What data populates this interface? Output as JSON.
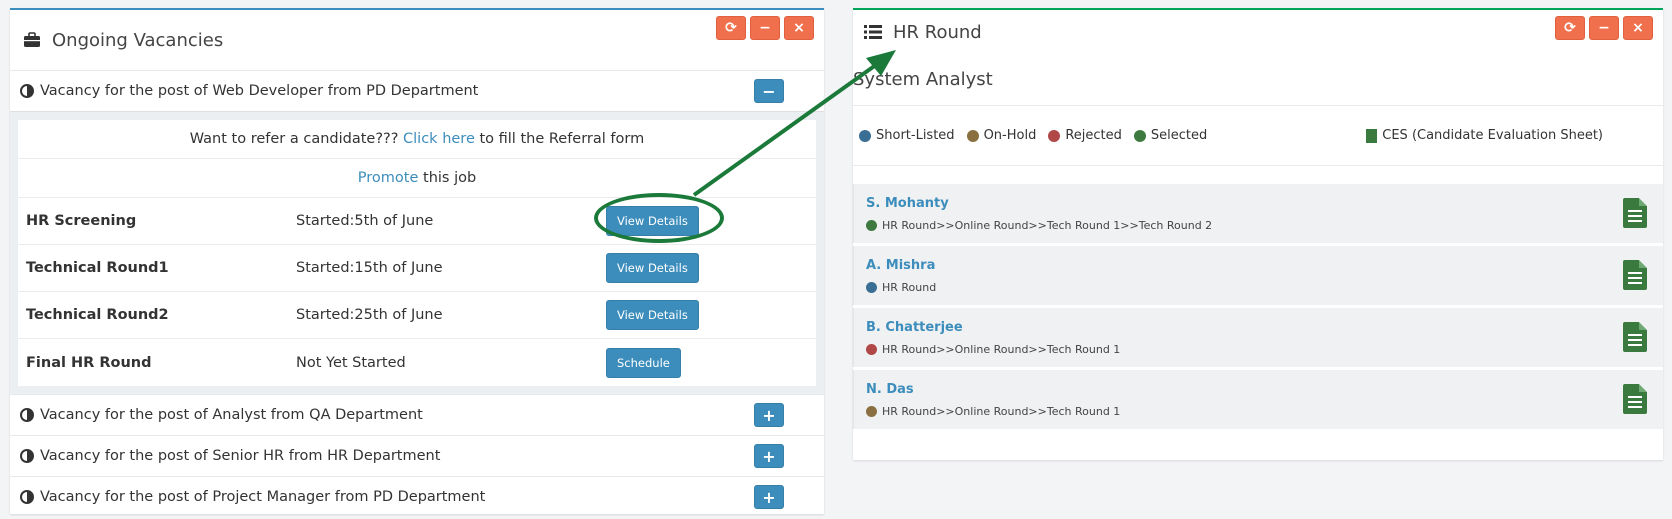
{
  "left_panel": {
    "title": "Ongoing Vacancies",
    "tools": {
      "refresh": "⟳",
      "minimize": "−",
      "close": "×"
    },
    "vacancies": [
      {
        "label": "Vacancy for the post of Web Developer from PD Department",
        "toggle": "−",
        "expanded": true
      },
      {
        "label": "Vacancy for the post of Analyst from QA Department",
        "toggle": "+",
        "expanded": false
      },
      {
        "label": "Vacancy for the post of Senior HR from HR Department",
        "toggle": "+",
        "expanded": false
      },
      {
        "label": "Vacancy for the post of Project Manager from PD Department",
        "toggle": "+",
        "expanded": false
      }
    ],
    "referral": {
      "prefix": "Want to refer a candidate??? ",
      "link": "Click here",
      "suffix": " to fill the Referral form"
    },
    "promote": {
      "link": "Promote",
      "suffix": " this job"
    },
    "stages": [
      {
        "name": "HR Screening",
        "status": "Started:5th of June",
        "action": "View Details"
      },
      {
        "name": "Technical Round1",
        "status": "Started:15th of June",
        "action": "View Details"
      },
      {
        "name": "Technical Round2",
        "status": "Started:25th of June",
        "action": "View Details"
      },
      {
        "name": "Final HR Round",
        "status": "Not Yet Started",
        "action": "Schedule"
      }
    ]
  },
  "right_panel": {
    "title": "HR Round",
    "tools": {
      "refresh": "⟳",
      "minimize": "−",
      "close": "×"
    },
    "position": "System Analyst",
    "legend": [
      {
        "label": "Short-Listed",
        "color": "#3b6e94"
      },
      {
        "label": "On-Hold",
        "color": "#8a7040"
      },
      {
        "label": "Rejected",
        "color": "#b04848"
      },
      {
        "label": "Selected",
        "color": "#3e7a40"
      }
    ],
    "ces_label": "CES (Candidate Evaluation Sheet)",
    "candidates": [
      {
        "name": "S. Mohanty",
        "path": "HR Round>>Online Round>>Tech Round 1>>Tech Round 2",
        "status_color": "#3e7a40"
      },
      {
        "name": "A. Mishra",
        "path": "HR Round",
        "status_color": "#3b6e94"
      },
      {
        "name": "B. Chatterjee",
        "path": "HR Round>>Online Round>>Tech Round 1",
        "status_color": "#b04848"
      },
      {
        "name": "N. Das",
        "path": "HR Round>>Online Round>>Tech Round 1",
        "status_color": "#8a7040"
      }
    ]
  },
  "colors": {
    "primary": "#3c8dbc",
    "tool": "#f0704d",
    "annotation": "#1b7a3a"
  }
}
